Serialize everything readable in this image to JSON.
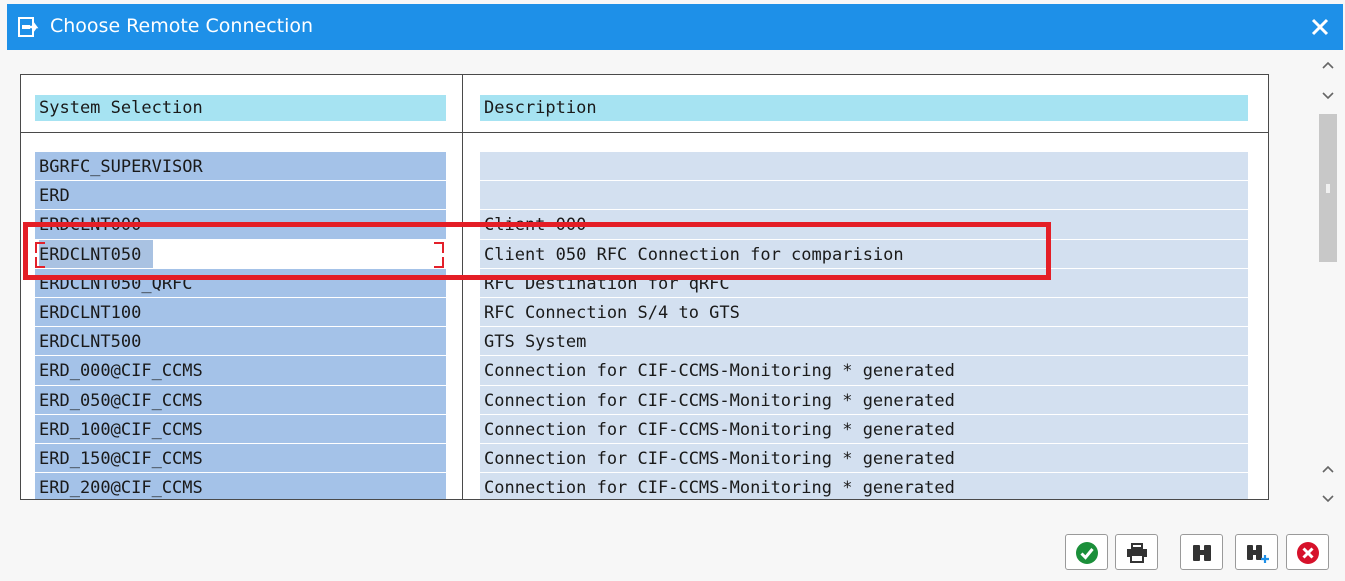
{
  "window": {
    "title": "Choose Remote Connection"
  },
  "table": {
    "columns": [
      "System Selection",
      "Description"
    ],
    "rows": [
      {
        "system": "BGRFC_SUPERVISOR",
        "description": ""
      },
      {
        "system": "ERD",
        "description": ""
      },
      {
        "system": "ERDCLNT000",
        "description": "Client 000"
      },
      {
        "system": "ERDCLNT050",
        "description": "Client 050 RFC Connection for comparision"
      },
      {
        "system": "ERDCLNT050_QRFC",
        "description": "RFC Destination for qRFC"
      },
      {
        "system": "ERDCLNT100",
        "description": "RFC Connection S/4 to GTS"
      },
      {
        "system": "ERDCLNT500",
        "description": "GTS System"
      },
      {
        "system": "ERD_000@CIF_CCMS",
        "description": "Connection for CIF-CCMS-Monitoring * generated"
      },
      {
        "system": "ERD_050@CIF_CCMS",
        "description": "Connection for CIF-CCMS-Monitoring * generated"
      },
      {
        "system": "ERD_100@CIF_CCMS",
        "description": "Connection for CIF-CCMS-Monitoring * generated"
      },
      {
        "system": "ERD_150@CIF_CCMS",
        "description": "Connection for CIF-CCMS-Monitoring * generated"
      },
      {
        "system": "ERD_200@CIF_CCMS",
        "description": "Connection for CIF-CCMS-Monitoring * generated"
      }
    ]
  },
  "toolbar": {
    "buttons": [
      "confirm-icon",
      "print-icon",
      "find-icon",
      "find-next-icon",
      "cancel-icon"
    ]
  },
  "colors": {
    "titlebar": "#1e90e8",
    "header": "#a6e3f2",
    "system_cell": "#a4c2e8",
    "description_cell": "#d3e0f0",
    "highlight": "#e41e26"
  }
}
